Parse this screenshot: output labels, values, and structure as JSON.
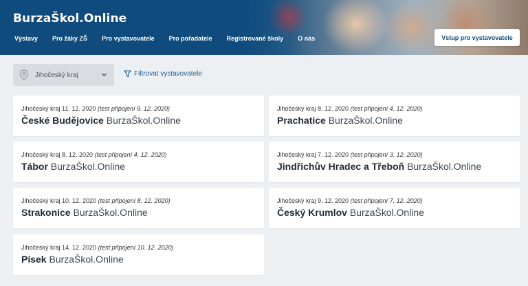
{
  "header": {
    "logo": "BurzaŠkol.Online",
    "nav": [
      "Výstavy",
      "Pro žáky ZŠ",
      "Pro vystavovatele",
      "Pro pořadatele",
      "Registrované školy",
      "O nás"
    ],
    "cta_label": "Vstup pro vystavovatele"
  },
  "filters": {
    "region": "Jihočeský kraj",
    "filter_label": "Filtrovat vystavovatele"
  },
  "events": [
    {
      "meta": "Jihočeský kraj 11. 12. 2020",
      "test": "(test připojení 9. 12. 2020)",
      "city": "České Budějovice",
      "brand": "BurzaŠkol.Online"
    },
    {
      "meta": "Jihočeský kraj 8. 12. 2020",
      "test": "(test připojení 4. 12. 2020)",
      "city": "Prachatice",
      "brand": "BurzaŠkol.Online"
    },
    {
      "meta": "Jihočeský kraj 8. 12. 2020",
      "test": "(test připojení 4. 12. 2020)",
      "city": "Tábor",
      "brand": "BurzaŠkol.Online"
    },
    {
      "meta": "Jihočeský kraj 7. 12. 2020",
      "test": "(test připojení 3. 12. 2020)",
      "city": "Jindřichův Hradec a Třeboň",
      "brand": "BurzaŠkol.Online"
    },
    {
      "meta": "Jihočeský kraj 10. 12. 2020",
      "test": "(test připojení 8. 12. 2020)",
      "city": "Strakonice",
      "brand": "BurzaŠkol.Online"
    },
    {
      "meta": "Jihočeský kraj 9. 12. 2020",
      "test": "(test připojení 7. 12. 2020)",
      "city": "Český Krumlov",
      "brand": "BurzaŠkol.Online"
    },
    {
      "meta": "Jihočeský kraj 14. 12. 2020",
      "test": "(test připojení 10. 12. 2020)",
      "city": "Písek",
      "brand": "BurzaŠkol.Online"
    }
  ],
  "icons": {
    "region": "map-pin-icon",
    "dropdown": "chevron-down-icon",
    "filter": "funnel-icon"
  },
  "colors": {
    "header_bg": "#0f4c7d",
    "page_bg": "#ecf0f3",
    "link": "#1f5f96"
  }
}
